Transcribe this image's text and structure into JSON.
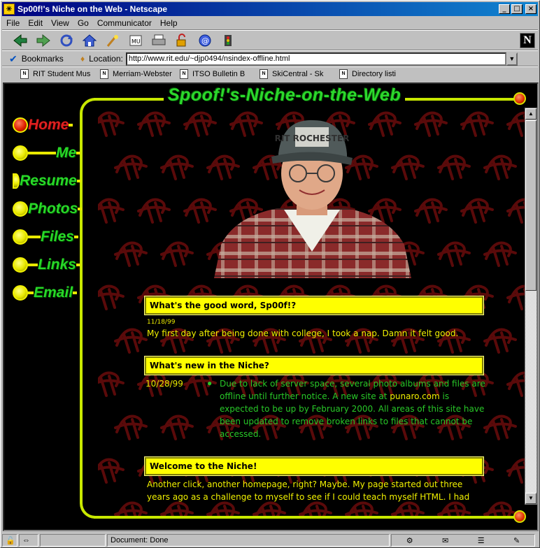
{
  "window": {
    "title": "Sp00f!'s Niche on the Web - Netscape",
    "controls": [
      "_",
      "□",
      "×"
    ]
  },
  "menu": [
    "File",
    "Edit",
    "View",
    "Go",
    "Communicator",
    "Help"
  ],
  "toolbar": {
    "buttons": [
      "back-icon",
      "forward-icon",
      "reload-icon",
      "home-icon",
      "search-icon",
      "my-netscape-icon",
      "print-icon",
      "security-icon",
      "shop-icon",
      "stop-icon"
    ],
    "logo": "N"
  },
  "location": {
    "bookmarks_label": "Bookmarks",
    "location_label": "Location:",
    "url": "http://www.rit.edu/~djp0494/nsindex-offline.html"
  },
  "personal_toolbar": [
    "RIT Student Mus",
    "Merriam-Webster",
    "ITSO Bulletin B",
    "SkiCentral - Sk",
    "Directory listi"
  ],
  "page": {
    "site_title": "Spoof!'s-Niche-on-the-Web",
    "nav": [
      {
        "label": "Home",
        "active": true
      },
      {
        "label": "Me",
        "active": false
      },
      {
        "label": "Resume",
        "active": false
      },
      {
        "label": "Photos",
        "active": false
      },
      {
        "label": "Files",
        "active": false
      },
      {
        "label": "Links",
        "active": false
      },
      {
        "label": "Email",
        "active": false
      }
    ],
    "sections": {
      "good_word": {
        "heading": "What's the good word, Sp00f!?",
        "date": "11/18/99",
        "text": "My first day after being done with college, I took a nap. Damn it felt good."
      },
      "whats_new": {
        "heading": "What's new in the Niche?",
        "date": "10/28/99",
        "text_before": "Due to lack of server space, several photo albums and files are offline until further notice. A new site at ",
        "link": "punaro.com",
        "text_after": " is expected to be up by February 2000. All areas of this site have been updated to remove broken links to files that cannot be accessed."
      },
      "welcome": {
        "heading": "Welcome to the Niche!",
        "text": "Another click, another homepage, right? Maybe. My page started out three years ago as a challenge to myself to see if I could teach myself HTML. I had"
      }
    },
    "cap_text": "RIT ROCHESTER"
  },
  "status": {
    "text": "Document: Done"
  }
}
